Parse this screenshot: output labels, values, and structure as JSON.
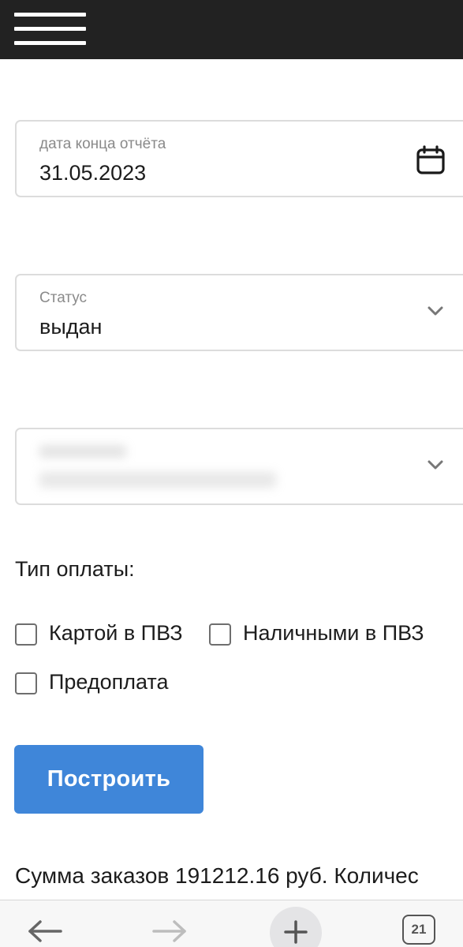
{
  "menu": {
    "icon": "hamburger-menu-icon"
  },
  "filters": {
    "end_date": {
      "label": "дата конца отчёта",
      "value": "31.05.2023",
      "icon": "calendar-icon"
    },
    "status": {
      "label": "Статус",
      "value": "выдан",
      "icon": "chevron-down-icon"
    },
    "third_select": {
      "icon": "chevron-down-icon"
    }
  },
  "payment": {
    "title": "Тип оплаты:",
    "options": [
      {
        "label": "Картой в ПВЗ",
        "checked": false
      },
      {
        "label": "Наличными в ПВЗ",
        "checked": false
      },
      {
        "label": "Предоплата",
        "checked": false
      }
    ]
  },
  "actions": {
    "build_label": "Построить"
  },
  "summary": {
    "text": "Сумма заказов 191212.16 руб. Количес"
  },
  "browser_toolbar": {
    "tabs_count": "21"
  },
  "colors": {
    "topbar": "#222222",
    "primary_button": "#3f86d9",
    "field_border": "#dcdcdc",
    "label_gray": "#8a8a8a"
  }
}
